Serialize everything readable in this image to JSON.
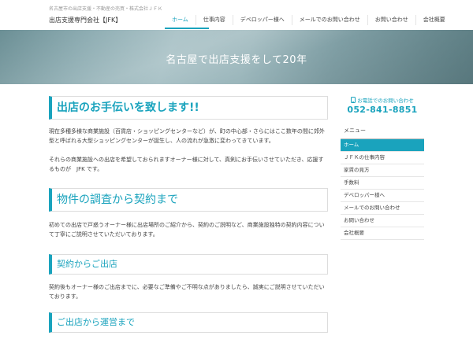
{
  "header": {
    "tagline": "名古屋市の出店支援・不動産の売買・株式会社ＪＦＫ",
    "site_title": "出店支援専門会社【JFK】",
    "nav": [
      "ホーム",
      "仕事内容",
      "デベロッパー様へ",
      "メールでのお問い合わせ",
      "お問い合わせ",
      "会社概要"
    ]
  },
  "hero": {
    "title": "名古屋で出店支援をして20年"
  },
  "main": {
    "section1_heading": "出店のお手伝いを致します!!",
    "section1_p1": "現在多種多様な商業施設（百貨店・ショッピングセンターなど）が、町の中心部・さらにはここ数年の間に郊外型と呼ばれる大型ショッピングセンターが誕生し、人の流れが急激に変わってきています。",
    "section1_p2": "それらの商業施設への出店を希望しておられますオーナー様に対して、真剣にお手伝いさせていただき、応援するものが　JFK です。",
    "section2_heading": "物件の調査から契約まで",
    "section2_p": "初めての出店で戸惑うオーナー様に出店場所のご紹介から、契約のご説明など、商業施設独特の契約内容について丁寧にご説明させていただいております。",
    "section3_heading": "契約からご出店",
    "section3_p": "契約後もオーナー様のご出店までに、必要なご準備やご不明な点がありましたら、誠実にご説明させていただいております。",
    "section4_heading": "ご出店から運営まで"
  },
  "sidebar": {
    "phone_label": "お電話でのお問い合わせ",
    "phone_number": "052-841-8851",
    "menu_title": "メニュー",
    "menu_items": [
      "ホーム",
      "ＪＦＫの仕事内容",
      "家賃の見方",
      "手数料",
      "デベロッパー様へ",
      "メールでのお問い合わせ",
      "お問い合わせ",
      "会社概要"
    ]
  },
  "colors": {
    "accent": "#1aa3bd"
  }
}
